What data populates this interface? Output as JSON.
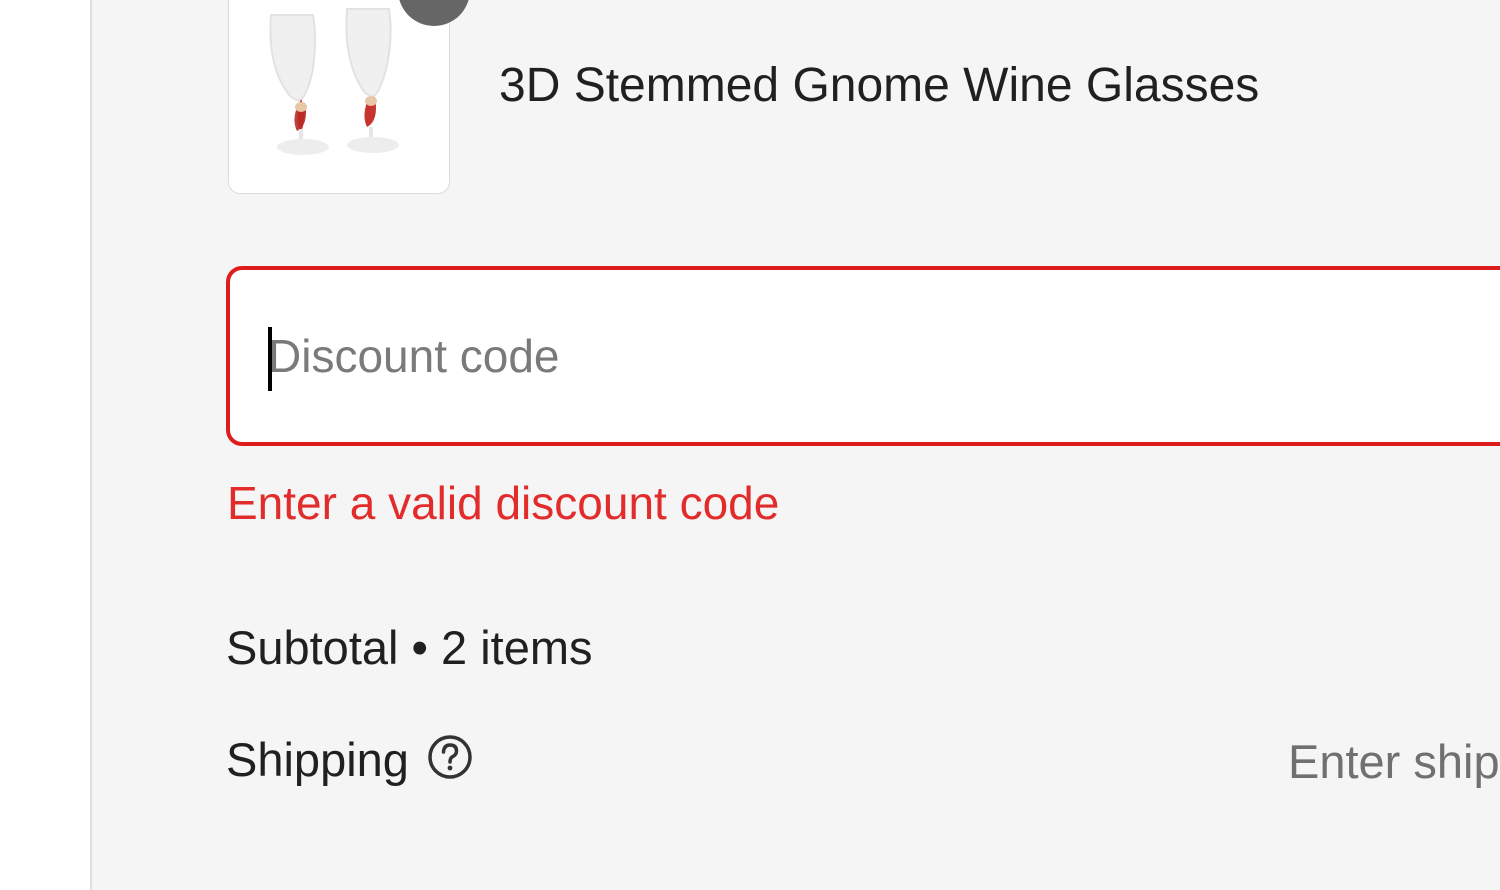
{
  "product": {
    "name": "3D Stemmed Gnome Wine Glasses",
    "image_icon": "wine-glasses-image",
    "quantity": ""
  },
  "discount": {
    "placeholder": "Discount code",
    "value": "",
    "error": "Enter a valid discount code",
    "border_color": "#dd1d1d",
    "error_color": "#e22c2c"
  },
  "totals": {
    "subtotal_label": "Subtotal • 2 items",
    "shipping_label": "Shipping",
    "shipping_help_icon": "question-circle-icon",
    "shipping_value": "Enter ship"
  },
  "colors": {
    "panel_bg": "#f5f5f5",
    "text": "#202020",
    "muted_text": "#707070"
  }
}
